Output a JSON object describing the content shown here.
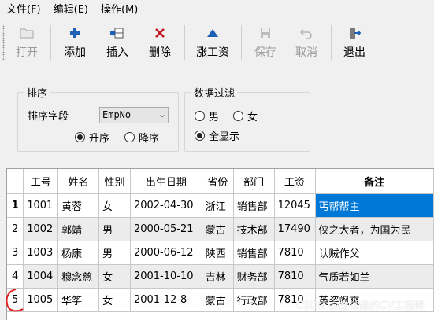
{
  "menu": [
    {
      "label": "文件(F)"
    },
    {
      "label": "编辑(E)"
    },
    {
      "label": "操作(M)"
    }
  ],
  "toolbar": {
    "open": "打开",
    "add": "添加",
    "insert": "插入",
    "delete": "删除",
    "raise": "涨工资",
    "save": "保存",
    "cancel": "取消",
    "exit": "退出"
  },
  "sort_group": {
    "title": "排序",
    "field_label": "排序字段",
    "field_value": "EmpNo",
    "asc": "升序",
    "desc": "降序",
    "selected": "asc"
  },
  "filter_group": {
    "title": "数据过滤",
    "male": "男",
    "female": "女",
    "all": "全显示",
    "selected": "all"
  },
  "grid": {
    "columns": [
      "工号",
      "姓名",
      "性别",
      "出生日期",
      "省份",
      "部门",
      "工资",
      "备注"
    ],
    "rows": [
      [
        "1",
        "1001",
        "黄蓉",
        "女",
        "2002-04-30",
        "浙江",
        "销售部",
        "12045",
        "丐帮帮主"
      ],
      [
        "2",
        "1002",
        "郭靖",
        "男",
        "2000-05-21",
        "蒙古",
        "技术部",
        "17490",
        "侠之大者，为国为民"
      ],
      [
        "3",
        "1003",
        "杨康",
        "男",
        "2000-06-12",
        "陕西",
        "销售部",
        "7810",
        "认贼作父"
      ],
      [
        "4",
        "1004",
        "穆念慈",
        "女",
        "2001-10-10",
        "吉林",
        "财务部",
        "7810",
        "气质若如兰"
      ],
      [
        "5",
        "1005",
        "华筝",
        "女",
        "2001-12-8",
        "蒙古",
        "行政部",
        "7810",
        "英姿飒爽"
      ]
    ]
  },
  "watermark": "CSDN @尝试做的CV工程师",
  "colors": {
    "selection": "#0078d7",
    "add_icon": "#1f5fb5",
    "delete_icon": "#c0161c",
    "annotation": "#e02020"
  }
}
